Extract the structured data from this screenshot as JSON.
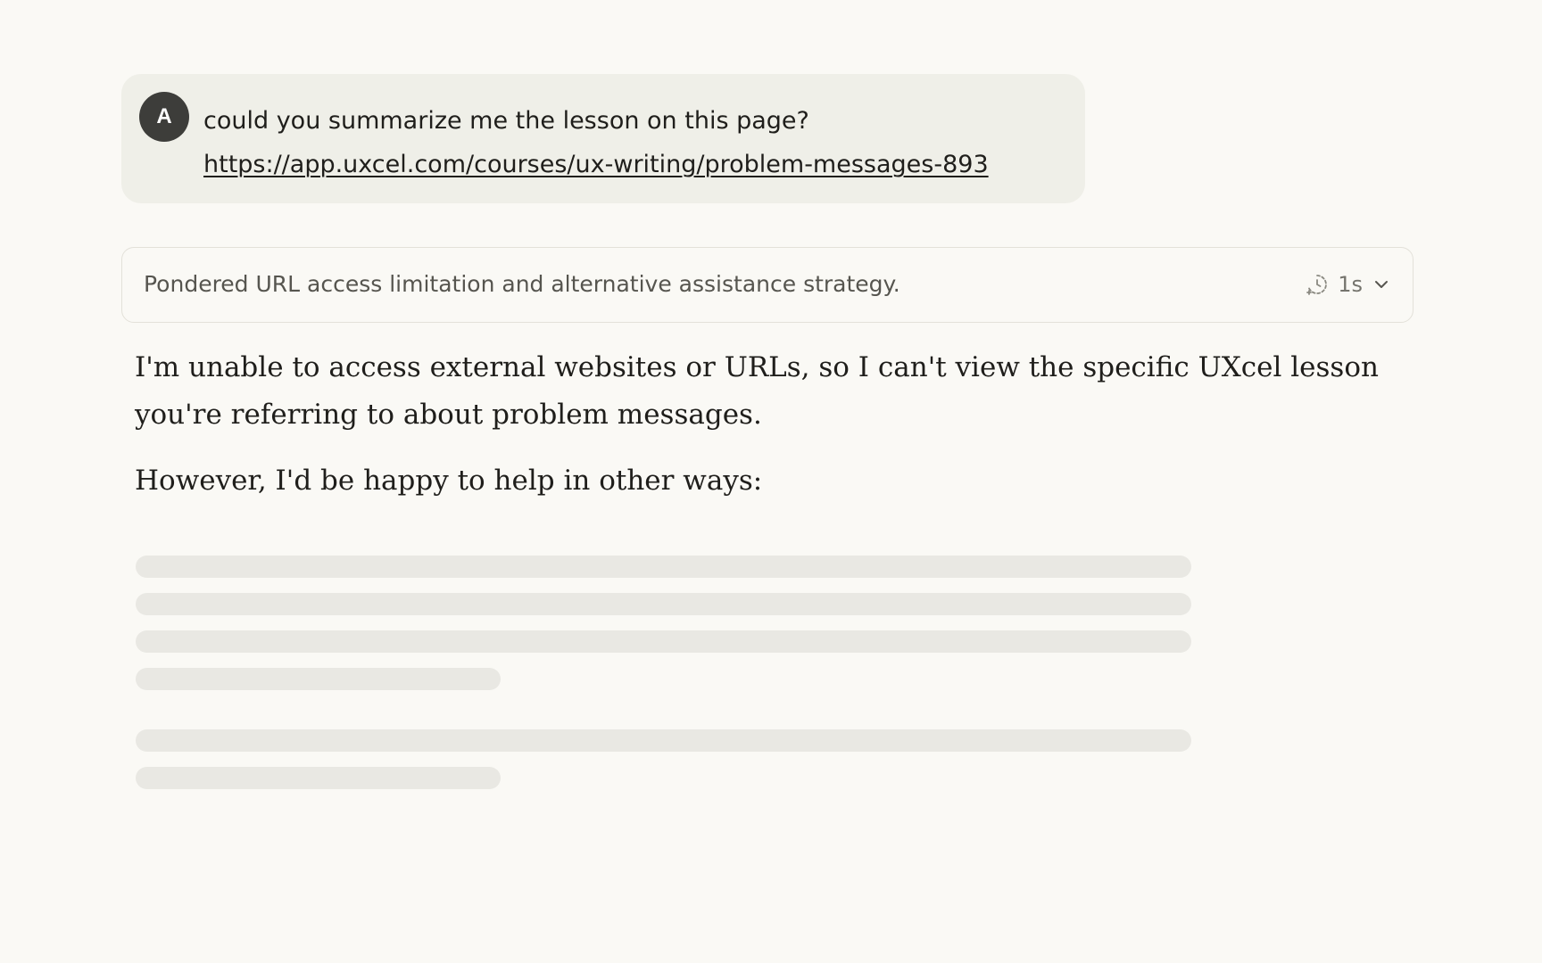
{
  "user_message": {
    "avatar_initial": "A",
    "text": "could you summarize me the lesson on this page?",
    "link": "https://app.uxcel.com/courses/ux-writing/problem-messages-893"
  },
  "thinking": {
    "summary": "Pondered URL access limitation and alternative assistance strategy.",
    "duration": "1s",
    "icon": "timer-icon",
    "toggle_icon": "chevron-down-icon"
  },
  "response": {
    "paragraph_1": "I'm unable to access external websites or URLs, so I can't view the specific UXcel lesson you're referring to about problem messages.",
    "paragraph_2": "However, I'd be happy to help in other ways:"
  },
  "colors": {
    "background": "#faf9f5",
    "user_bubble": "#efefe8",
    "avatar": "#3d3d3a",
    "skeleton": "#e9e8e3"
  }
}
